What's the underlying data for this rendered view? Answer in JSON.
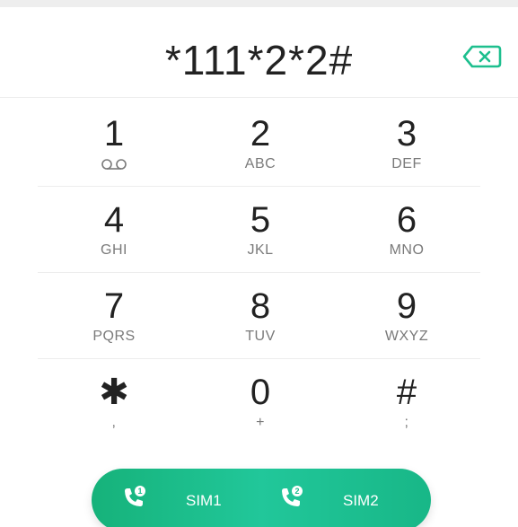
{
  "dialer": {
    "number": "*111*2*2#",
    "backspace_icon": "backspace-icon"
  },
  "keypad": {
    "rows": [
      [
        {
          "digit": "1",
          "letters": "",
          "icon": "voicemail-icon"
        },
        {
          "digit": "2",
          "letters": "ABC"
        },
        {
          "digit": "3",
          "letters": "DEF"
        }
      ],
      [
        {
          "digit": "4",
          "letters": "GHI"
        },
        {
          "digit": "5",
          "letters": "JKL"
        },
        {
          "digit": "6",
          "letters": "MNO"
        }
      ],
      [
        {
          "digit": "7",
          "letters": "PQRS"
        },
        {
          "digit": "8",
          "letters": "TUV"
        },
        {
          "digit": "9",
          "letters": "WXYZ"
        }
      ],
      [
        {
          "digit": "✱",
          "letters": ","
        },
        {
          "digit": "0",
          "letters": "+"
        },
        {
          "digit": "#",
          "letters": ";"
        }
      ]
    ]
  },
  "call_bar": {
    "sim1_label": "SIM1",
    "sim2_label": "SIM2",
    "sim1_icon": "phone-sim1-icon",
    "sim2_icon": "phone-sim2-icon",
    "accent_color": "#1dbf8e"
  }
}
